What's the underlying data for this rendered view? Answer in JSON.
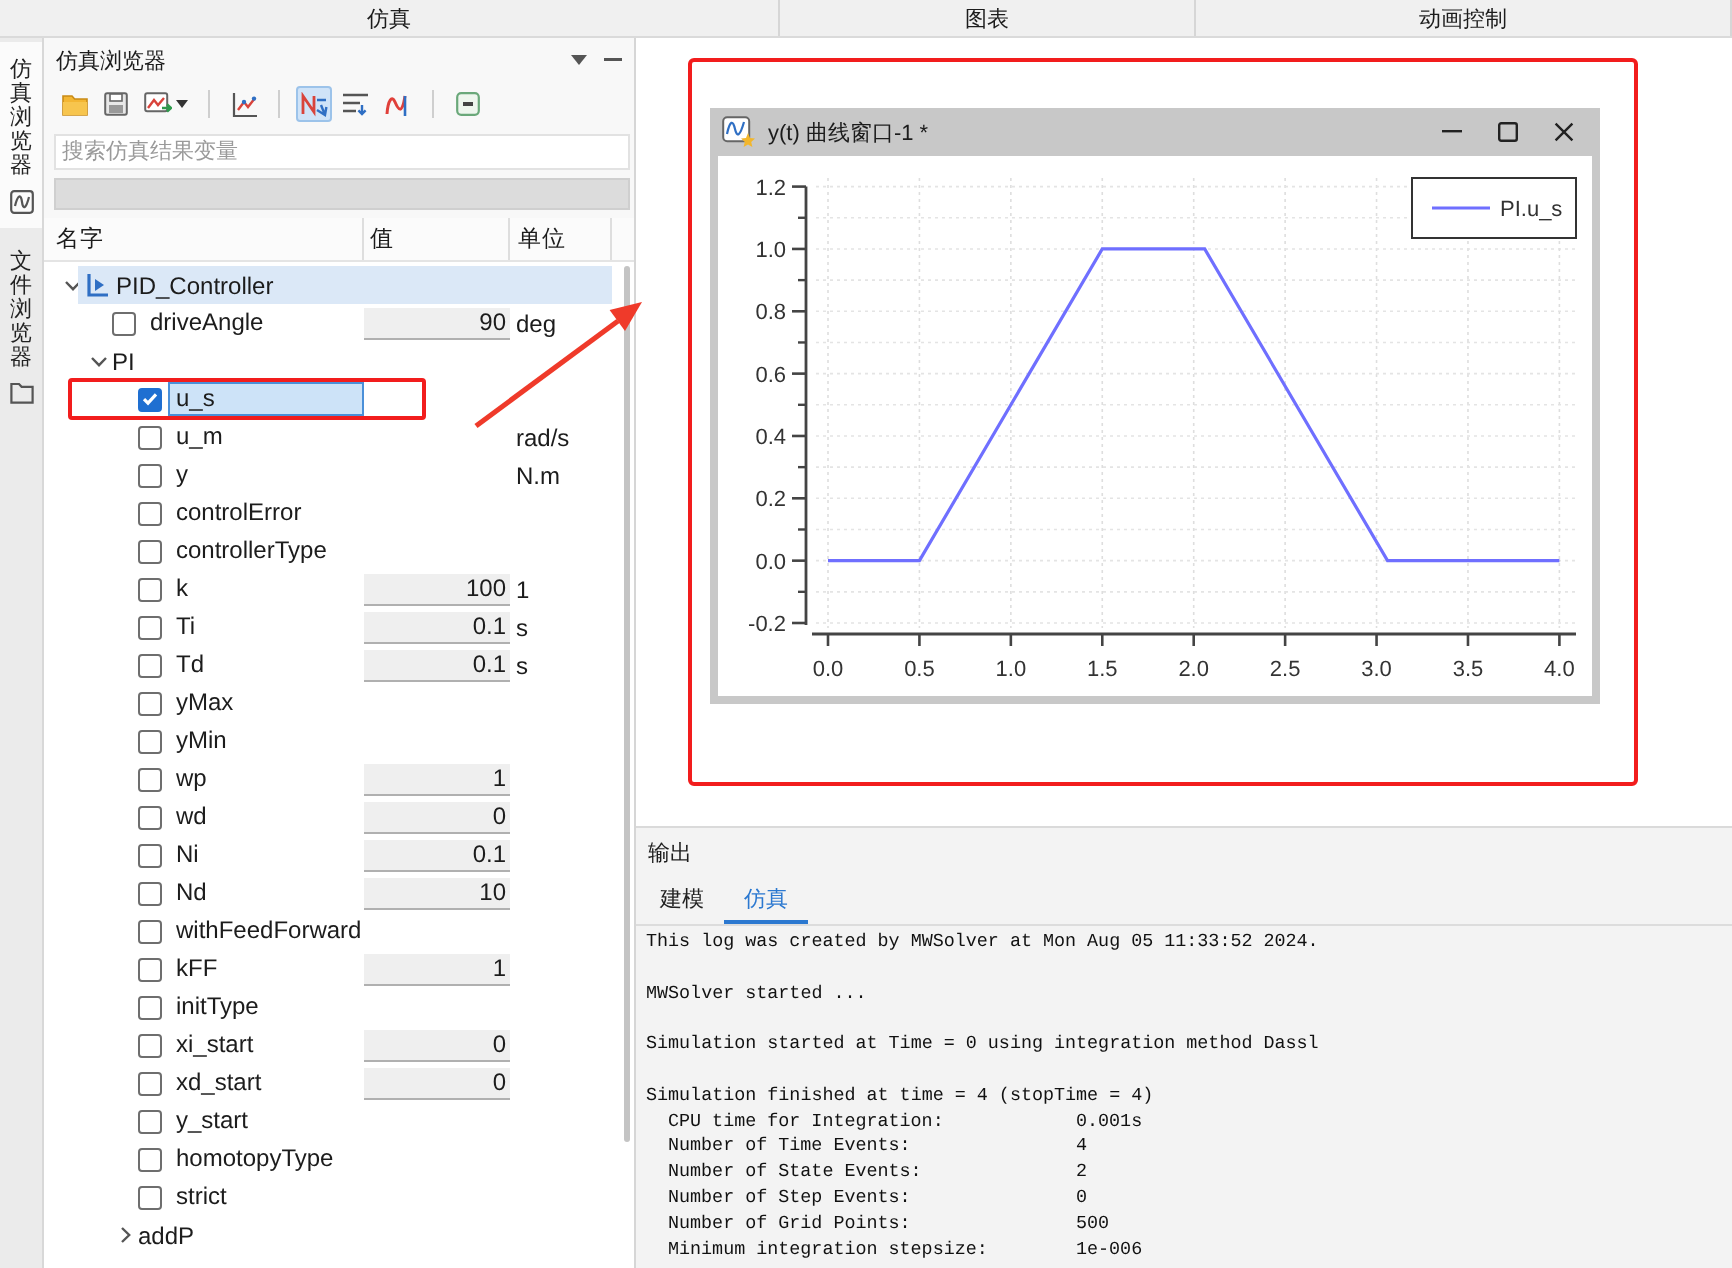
{
  "ribbon_groups": [
    "仿真",
    "图表",
    "动画控制"
  ],
  "side_tabs": [
    {
      "label": "仿真浏览器",
      "selected": true
    },
    {
      "label": "文件浏览器",
      "selected": false
    }
  ],
  "browser": {
    "title": "仿真浏览器",
    "toolbar_toggles": [
      {
        "selected": true
      },
      {
        "selected": false
      },
      {
        "selected": false
      }
    ],
    "search": {
      "placeholder": "搜索仿真结果变量"
    },
    "columns": [
      "名字",
      "值",
      "单位"
    ],
    "tree": [
      {
        "kind": "model",
        "name": "PID_Controller",
        "expanded": true,
        "selected": true,
        "children": [
          {
            "kind": "variable",
            "name": "driveAngle",
            "checked": false,
            "selected": false,
            "value": "90",
            "unit": "deg"
          },
          {
            "kind": "component",
            "name": "PI",
            "expanded": true,
            "selected": false,
            "children": [
              {
                "kind": "variable",
                "name": "u_s",
                "checked": true,
                "selected": true
              },
              {
                "kind": "variable",
                "name": "u_m",
                "checked": false,
                "selected": false,
                "unit": "rad/s"
              },
              {
                "kind": "variable",
                "name": "y",
                "checked": false,
                "selected": false,
                "unit": "N.m"
              },
              {
                "kind": "variable",
                "name": "controlError",
                "checked": false,
                "selected": false
              },
              {
                "kind": "variable",
                "name": "controllerType",
                "checked": false,
                "selected": false
              },
              {
                "kind": "variable",
                "name": "k",
                "checked": false,
                "selected": false,
                "value": "100",
                "unit": "1"
              },
              {
                "kind": "variable",
                "name": "Ti",
                "checked": false,
                "selected": false,
                "value": "0.1",
                "unit": "s"
              },
              {
                "kind": "variable",
                "name": "Td",
                "checked": false,
                "selected": false,
                "value": "0.1",
                "unit": "s"
              },
              {
                "kind": "variable",
                "name": "yMax",
                "checked": false,
                "selected": false
              },
              {
                "kind": "variable",
                "name": "yMin",
                "checked": false,
                "selected": false
              },
              {
                "kind": "variable",
                "name": "wp",
                "checked": false,
                "selected": false,
                "value": "1"
              },
              {
                "kind": "variable",
                "name": "wd",
                "checked": false,
                "selected": false,
                "value": "0"
              },
              {
                "kind": "variable",
                "name": "Ni",
                "checked": false,
                "selected": false,
                "value": "0.1"
              },
              {
                "kind": "variable",
                "name": "Nd",
                "checked": false,
                "selected": false,
                "value": "10"
              },
              {
                "kind": "variable",
                "name": "withFeedForward",
                "checked": false,
                "selected": false
              },
              {
                "kind": "variable",
                "name": "kFF",
                "checked": false,
                "selected": false,
                "value": "1"
              },
              {
                "kind": "variable",
                "name": "initType",
                "checked": false,
                "selected": false
              },
              {
                "kind": "variable",
                "name": "xi_start",
                "checked": false,
                "selected": false,
                "value": "0"
              },
              {
                "kind": "variable",
                "name": "xd_start",
                "checked": false,
                "selected": false,
                "value": "0"
              },
              {
                "kind": "variable",
                "name": "y_start",
                "checked": false,
                "selected": false
              },
              {
                "kind": "variable",
                "name": "homotopyType",
                "checked": false,
                "selected": false
              },
              {
                "kind": "variable",
                "name": "strict",
                "checked": false,
                "selected": false
              },
              {
                "kind": "component",
                "name": "addP",
                "expanded": false,
                "selected": false
              }
            ]
          }
        ]
      }
    ]
  },
  "chart_panel": {
    "window": {
      "title": "y(t) 曲线窗口-1 *"
    },
    "chart_data": {
      "type": "line",
      "grid": true,
      "x": [
        0,
        0.5,
        1.5,
        2.06,
        3.06,
        4
      ],
      "series": [
        {
          "name": "PI.u_s",
          "color": "#6f6fff",
          "values": [
            0,
            0,
            1,
            1,
            0,
            0
          ]
        }
      ],
      "xlim": [
        0,
        4
      ],
      "ylim": [
        -0.2,
        1.2
      ],
      "xticks": [
        {
          "value": 0,
          "label": "0.0"
        },
        {
          "value": 0.5,
          "label": "0.5"
        },
        {
          "value": 1,
          "label": "1.0"
        },
        {
          "value": 1.5,
          "label": "1.5"
        },
        {
          "value": 2,
          "label": "2.0"
        },
        {
          "value": 2.5,
          "label": "2.5"
        },
        {
          "value": 3,
          "label": "3.0"
        },
        {
          "value": 3.5,
          "label": "3.5"
        },
        {
          "value": 4,
          "label": "4.0"
        }
      ],
      "yticks": [
        {
          "value": -0.2,
          "label": "-0.2"
        },
        {
          "value": 0,
          "label": "0.0"
        },
        {
          "value": 0.2,
          "label": "0.2"
        },
        {
          "value": 0.4,
          "label": "0.4"
        },
        {
          "value": 0.6,
          "label": "0.6"
        },
        {
          "value": 0.8,
          "label": "0.8"
        },
        {
          "value": 1,
          "label": "1.0"
        },
        {
          "value": 1.2,
          "label": "1.2"
        }
      ]
    }
  },
  "output": {
    "title": "输出",
    "tabs": [
      {
        "label": "建模",
        "selected": false
      },
      {
        "label": "仿真",
        "selected": true
      }
    ],
    "log": [
      {
        "lines": [
          "This log was created by MWSolver at Mon Aug 05 11:33:52 2024."
        ]
      },
      {
        "lines": [
          "MWSolver started ..."
        ]
      },
      {
        "lines": [
          "Simulation started at Time = 0 using integration method Dassl"
        ]
      },
      {
        "lines": [
          "Simulation finished at time = 4 (stopTime = 4)"
        ],
        "stats": [
          {
            "label": "CPU time for Integration:",
            "value": "0.001s"
          },
          {
            "label": "Number of Time Events:",
            "value": "4"
          },
          {
            "label": "Number of State Events:",
            "value": "2"
          },
          {
            "label": "Number of Step Events:",
            "value": "0"
          },
          {
            "label": "Number of Grid Points:",
            "value": "500"
          },
          {
            "label": "Minimum integration stepsize:",
            "value": "1e-006"
          }
        ]
      }
    ]
  },
  "annotations": {
    "checked_row_frame": true,
    "chart_frame": true,
    "arrow": true
  }
}
